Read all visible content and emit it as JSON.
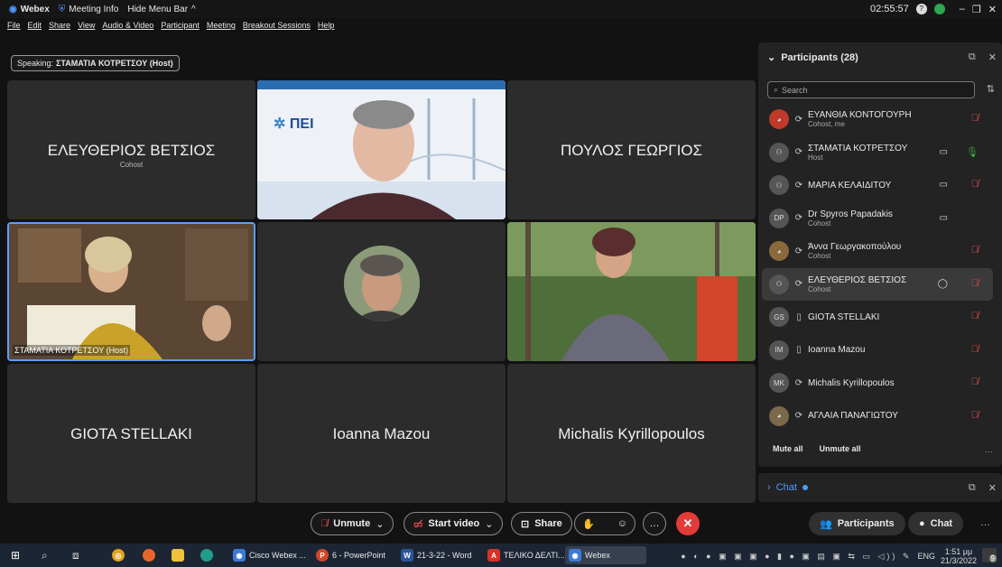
{
  "titlebar": {
    "app": "Webex",
    "meeting_info": "Meeting Info",
    "hide_menu": "Hide Menu Bar",
    "clock": "02:55:57"
  },
  "menu": [
    "File",
    "Edit",
    "Share",
    "View",
    "Audio & Video",
    "Participant",
    "Meeting",
    "Breakout Sessions",
    "Help"
  ],
  "speaking": {
    "label": "Speaking:",
    "name": "ΣΤΑΜΑΤΙΑ ΚΟΤΡΕΤΣΟΥ (Host)"
  },
  "tiles": {
    "t1_name": "ΕΛΕΥΘΕΡΙΟΣ ΒΕΤΣΙΟΣ",
    "t1_role": "Cohost",
    "t3_name": "ΠΟΥΛΟΣ ΓΕΩΡΓΙΟΣ",
    "t4_label": "ΣΤΑΜΑΤΙΑ ΚΟΤΡΕΤΣΟΥ (Host)",
    "t7_name": "GIOTA STELLAKI",
    "t8_name": "Ioanna Mazou",
    "t9_name": "Michalis Kyrillopoulos",
    "logo_text": "ΠΕΙ"
  },
  "participants": {
    "title": "Participants (28)",
    "search_placeholder": "Search",
    "mute_all": "Mute all",
    "unmute_all": "Unmute all",
    "items": [
      {
        "name": "ΕΥΑΝΘΙΑ ΚΟΝΤΟΓΟΥΡΗ",
        "role": "Cohost, me",
        "avatar": "",
        "mic": "muted"
      },
      {
        "name": "ΣΤΑΜΑΤΙΑ ΚΟΤΡΕΤΣΟΥ",
        "role": "Host",
        "avatar": "",
        "mic": "on"
      },
      {
        "name": "ΜΑΡΙΑ ΚΕΛΑΙΔΙΤΟΥ",
        "role": "",
        "avatar": "",
        "mic": "muted"
      },
      {
        "name": "Dr Spyros Papadakis",
        "role": "Cohost",
        "avatar": "DP",
        "mic": "none"
      },
      {
        "name": "Άννα Γεωργακοπούλου",
        "role": "Cohost",
        "avatar": "",
        "mic": "muted"
      },
      {
        "name": "ΕΛΕΥΘΕΡΙΟΣ ΒΕΤΣΙΟΣ",
        "role": "Cohost",
        "avatar": "",
        "mic": "muted"
      },
      {
        "name": "GIOTA STELLAKI",
        "role": "",
        "avatar": "GS",
        "mic": "muted"
      },
      {
        "name": "Ioanna Mazou",
        "role": "",
        "avatar": "IM",
        "mic": "muted"
      },
      {
        "name": "Michalis Kyrillopoulos",
        "role": "",
        "avatar": "MK",
        "mic": "muted"
      },
      {
        "name": "ΑΓΛΑΙΑ ΠΑΝΑΓΙΩΤΟΥ",
        "role": "",
        "avatar": "",
        "mic": "muted"
      }
    ]
  },
  "chat": {
    "label": "Chat"
  },
  "controls": {
    "unmute": "Unmute",
    "start_video": "Start video",
    "share": "Share",
    "participants": "Participants",
    "chat": "Chat"
  },
  "taskbar": {
    "apps": [
      "Cisco Webex ...",
      "6 - PowerPoint",
      "21-3-22 - Word",
      "ΤΕΛΙΚΟ ΔΕΛΤΙ...",
      "Webex"
    ],
    "lang": "ENG",
    "time": "1:51 μμ",
    "date": "21/3/2022",
    "notif": "9"
  },
  "colors": {
    "accent": "#4f9bff",
    "end": "#e33a3a",
    "muted": "#e04b4b",
    "speaking_border": "#5aa0ff"
  }
}
